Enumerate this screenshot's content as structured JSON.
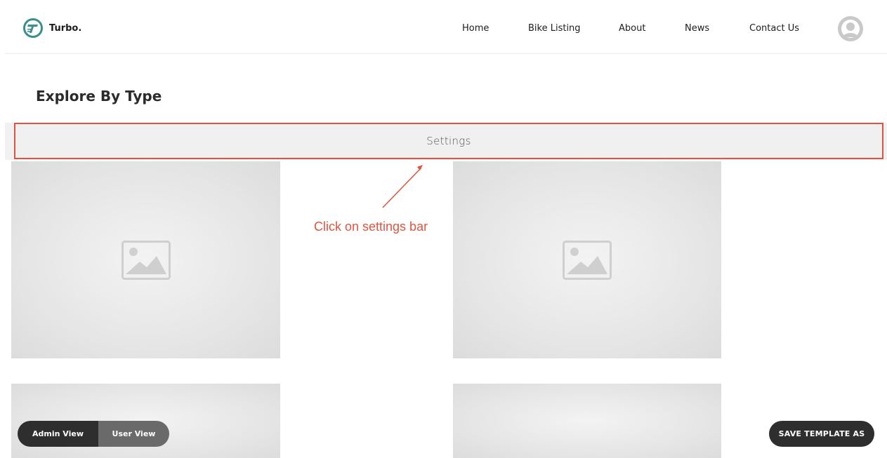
{
  "header": {
    "logo_text": "Turbo.",
    "nav": [
      {
        "label": "Home"
      },
      {
        "label": "Bike Listing"
      },
      {
        "label": "About"
      },
      {
        "label": "News"
      },
      {
        "label": "Contact Us"
      }
    ]
  },
  "section": {
    "title": "Explore By Type"
  },
  "settings_bar": {
    "label": "Settings"
  },
  "annotation": {
    "text": "Click on settings bar",
    "color": "#e0533e"
  },
  "controls": {
    "admin_view": "Admin View",
    "user_view": "User View",
    "save_template": "SAVE TEMPLATE AS"
  },
  "colors": {
    "brand": "#3a8e8f",
    "highlight": "#e0533e",
    "dark_button": "#2e2e2e"
  },
  "icons": {
    "logo": "turbo-logo-icon",
    "avatar": "user-avatar-icon",
    "placeholder": "image-placeholder-icon"
  }
}
